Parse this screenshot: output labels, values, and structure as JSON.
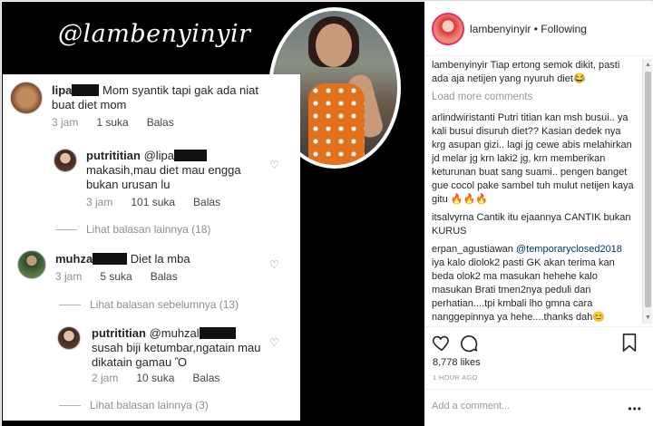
{
  "post": {
    "watermark": "@lambenyinyir",
    "screenshot": {
      "comments": [
        {
          "user": "lipa",
          "text": "Mom syantik tapi gak ada niat buat diet mom",
          "time": "3 jam",
          "likes": "1 suka",
          "reply": "Balas"
        },
        {
          "user": "putrititian",
          "mention": "@lipa",
          "text": "makasih,mau diet mau engga bukan urusan lu",
          "time": "3 jam",
          "likes": "101 suka",
          "reply": "Balas"
        },
        {
          "more": "Lihat balasan lainnya (18)"
        },
        {
          "user": "muhza",
          "text": "Diet la mba",
          "time": "3 jam",
          "likes": "5 suka",
          "reply": "Balas"
        },
        {
          "more": "Lihat balasan sebelumnya (13)"
        },
        {
          "user": "putrititian",
          "mention": "@muhzal",
          "text": "susah biji ketumbar,ngatain mau dikatain gamau Ὂ",
          "time": "2 jam",
          "likes": "10 suka",
          "reply": "Balas"
        },
        {
          "more": "Lihat balasan lainnya (3)"
        }
      ]
    }
  },
  "header": {
    "username": "lambenyinyir",
    "separator": " • ",
    "follow_status": "Following"
  },
  "caption": {
    "user": "lambenyinyir",
    "text": " Tiap ertong semok dikit, pasti ada aja netijen yang nyuruh diet😂"
  },
  "load_more": "Load more comments",
  "comments": [
    {
      "user": "arlindwiristanti",
      "text": " Putri titian kan msh busui.. ya kali busui disuruh diet?? Kasian dedek nya krg asupan gizi.. lagi jg cewe abis melahirkan jd melar jg krn laki2 jg, krn memberikan keturunan buat sang suami.. pengen banget gue cocol pake sambel tuh mulut netijen kaya gitu 🔥🔥🔥"
    },
    {
      "user": "itsalvyrna",
      "text": " Cantik itu ejaannya CANTIK bukan KURUS"
    },
    {
      "user": "erpan_agustiawan",
      "mention": "@temporaryclosed2018",
      "text": " iya kalo diolok2 pasti GK akan terima kan beda olok2 ma masukan hehehe kalo masukan Brati tmen2nya peduli dan perhatian....tpi kmbali lho gmna cara nanggepinnya ya hehe....thanks dah😊"
    }
  ],
  "likes": "8,778 likes",
  "timestamp": "1 HOUR AGO",
  "add_comment": {
    "placeholder": "Add a comment...",
    "more": "•••"
  },
  "colors": {
    "black_bg": "#000000",
    "link": "#003569",
    "muted": "#8e8e8e"
  }
}
